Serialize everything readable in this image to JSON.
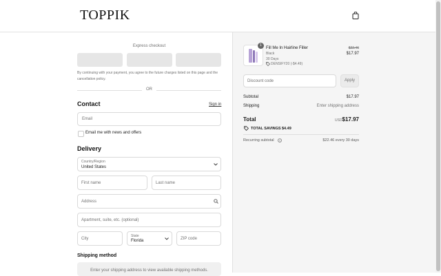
{
  "header": {
    "logo": "TOPPIK",
    "cart_icon": "shopping-bag-icon"
  },
  "express": {
    "label": "Express checkout",
    "consent": "By continuing with your payment, you agree to the future charges listed on this page and the cancellation policy.",
    "or": "OR"
  },
  "contact": {
    "title": "Contact",
    "sign_in": "Sign in",
    "email_placeholder": "Email",
    "newsletter_label": "Email me with news and offers"
  },
  "delivery": {
    "title": "Delivery",
    "country_label": "Country/Region",
    "country_value": "United States",
    "first_name": "First name",
    "last_name": "Last name",
    "address": "Address",
    "apartment": "Apartment, suite, etc. (optional)",
    "city": "City",
    "state_label": "State",
    "state_value": "Florida",
    "zip": "ZIP code"
  },
  "shipping_method": {
    "title": "Shipping method",
    "message": "Enter your shipping address to view available shipping methods."
  },
  "summary": {
    "product": {
      "name": "Fill Me In Hairline Filler",
      "variant": "Black",
      "plan": "30 Days",
      "discount": "DENSIFY20 (-$4.49)",
      "old_price": "$22.46",
      "price": "$17.97",
      "quantity": "1"
    },
    "discount_placeholder": "Discount code",
    "apply_label": "Apply",
    "subtotal_label": "Subtotal",
    "subtotal_value": "$17.97",
    "shipping_label": "Shipping",
    "shipping_value": "Enter shipping address",
    "total_label": "Total",
    "currency": "USD",
    "total_value": "$17.97",
    "savings_label": "TOTAL SAVINGS",
    "savings_value": "$4.49",
    "recurring_label": "Recurring subtotal",
    "recurring_value": "$22.46 every 30 days"
  }
}
